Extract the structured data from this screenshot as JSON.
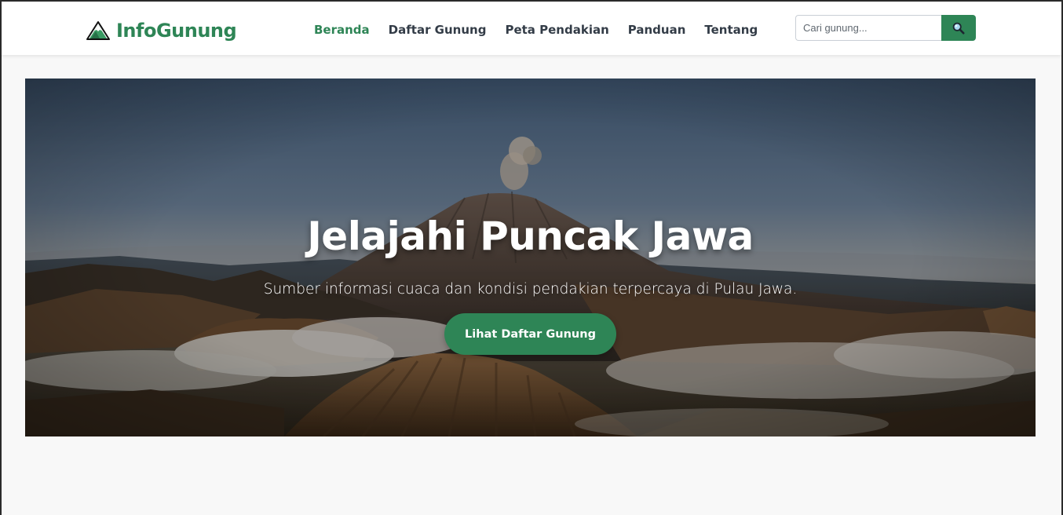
{
  "colors": {
    "accent": "#2e8556",
    "accent_dark": "#267047",
    "nav_text": "#333c47",
    "page_background": "#f8f8f8"
  },
  "navbar": {
    "brand": {
      "name": "InfoGunung",
      "logo_icon": "mountain-icon"
    },
    "links": [
      {
        "label": "Beranda",
        "active": true
      },
      {
        "label": "Daftar Gunung",
        "active": false
      },
      {
        "label": "Peta Pendakian",
        "active": false
      },
      {
        "label": "Panduan",
        "active": false
      },
      {
        "label": "Tentang",
        "active": false
      }
    ],
    "search": {
      "placeholder": "Cari gunung...",
      "value": "",
      "button_icon": "magnifier-icon"
    }
  },
  "hero": {
    "title": "Jelajahi Puncak Jawa",
    "subtitle": "Sumber informasi cuaca dan kondisi pendakian terpercaya di Pulau Jawa.",
    "button_label": "Lihat Daftar Gunung",
    "background_image": "volcano-landscape"
  }
}
